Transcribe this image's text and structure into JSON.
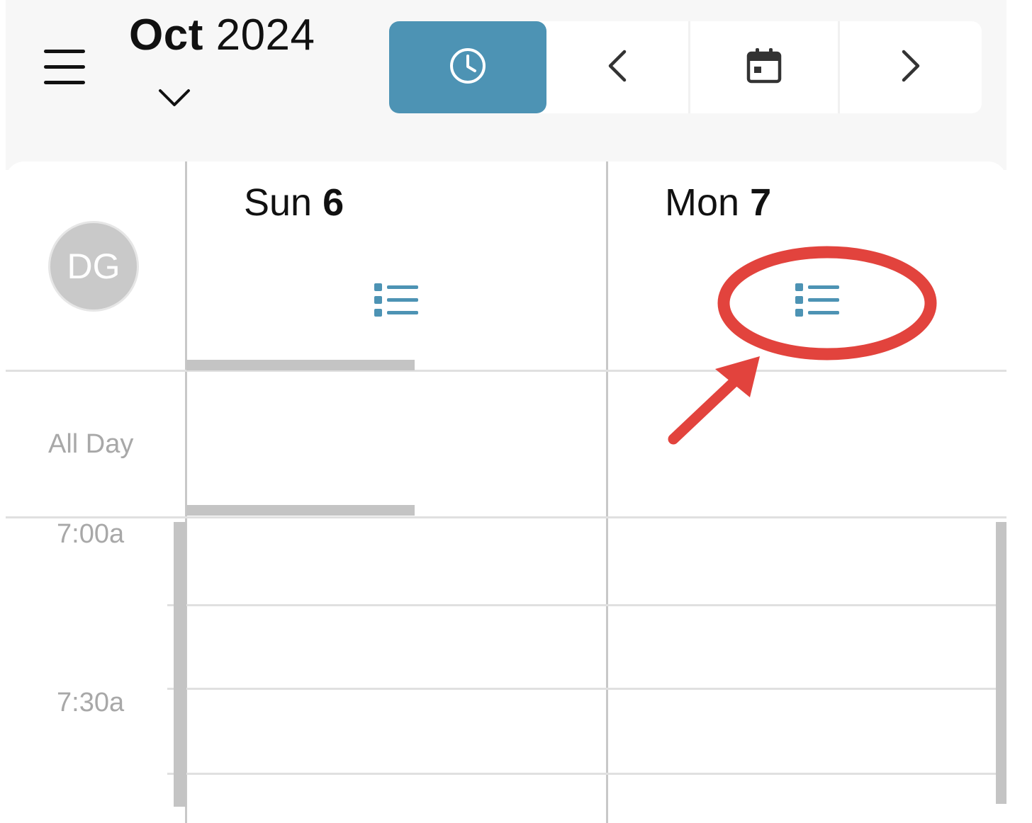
{
  "header": {
    "month": "Oct",
    "year": "2024"
  },
  "toolbar": {
    "buttons": [
      {
        "name": "time-view",
        "icon": "clock-icon",
        "active": true
      },
      {
        "name": "previous",
        "icon": "chevron-left-icon"
      },
      {
        "name": "today",
        "icon": "calendar-icon"
      },
      {
        "name": "next",
        "icon": "chevron-right-icon"
      }
    ],
    "accent_color": "#4d93b4"
  },
  "user": {
    "initials": "DG"
  },
  "days": [
    {
      "weekday": "Sun",
      "date": "6"
    },
    {
      "weekday": "Mon",
      "date": "7"
    }
  ],
  "grid": {
    "all_day_label": "All Day",
    "times": [
      "7:00a",
      "7:30a"
    ]
  },
  "annotation": {
    "color": "#e2433d",
    "shape": "ellipse-and-arrow",
    "target": "Mon 7 list icon"
  }
}
